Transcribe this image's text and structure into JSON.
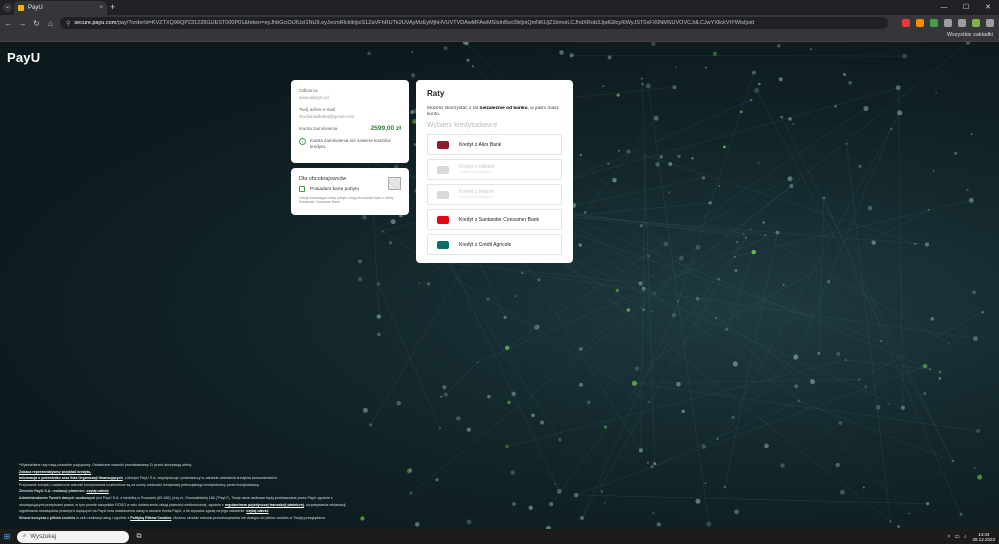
{
  "browser": {
    "tab_title": "PayU",
    "tab_close": "×",
    "new_tab": "+",
    "menu": "⌄",
    "min": "—",
    "max": "☐",
    "close": "✕",
    "back": "←",
    "forward": "→",
    "reload": "↻",
    "home": "⌂",
    "url_host": "secure.payu.com",
    "url_path": "/pay/?orderId=KVZTXQ96QP231228GUEST000P01&token=eyJhbGciOiJIUzI1NiJ9.eyJvcmRlcklkIjoiS1ZaVFhRUTk2UVAyMzEyMjhHVUVTVDAwMFAwMSIsInBvc0lkIjoiQmNKUjZ1bmoiLCJhdXRob3JpdGllcyI6WyJST0xFX0NMSUVOVCJdLCJwYXllckVtYWlsIjoid",
    "bookmarks": "Wszystkie zakładki"
  },
  "page": {
    "logo": "PayU",
    "summary": {
      "recipient_label": "Odbiorca",
      "recipient": "www.allegro.pl",
      "email_label": "Twój adres e-mail",
      "email": "studiobadhabit@gmail.com",
      "amount_label": "Kwota zamówienia",
      "amount": "2599,00 zł",
      "info_icon": "i",
      "info": "Kwota zamówienia nie zawiera kosztów kredytu."
    },
    "foreigners": {
      "title": "Dla obcokrajowców",
      "checkbox_label": "Posiadam kartę pobytu",
      "note": "Usługi dokładające kartę pobytu mogą skorzystać tylko z oferty Santander Consumer Bank."
    },
    "raty": {
      "title": "Raty",
      "desc_pre": "Możesz skorzystać z rat ",
      "desc_bold": "niezależnie od banku",
      "desc_post": ", w jakim masz konto.",
      "subtitle": "Wybierz kredytodawcę",
      "options": [
        {
          "label": "Kredyt z Alior Bank",
          "sub": "",
          "disabled": false,
          "icon": "alior-bank-logo-icon",
          "color": "#8b1e2b"
        },
        {
          "label": "Kredyt z mBank",
          "sub": "Chwilowo niedostępny",
          "disabled": true,
          "icon": "mbank-logo-icon",
          "color": "#d9d9d9"
        },
        {
          "label": "Kredyt z Inbank",
          "sub": "Chwilowo niedostępny",
          "disabled": true,
          "icon": "inbank-logo-icon",
          "color": "#d9d9d9"
        },
        {
          "label": "Kredyt z Santander Consumer Bank",
          "sub": "",
          "disabled": false,
          "icon": "santander-logo-icon",
          "color": "#e30613"
        },
        {
          "label": "Kredyt z Crédit Agricole",
          "sub": "",
          "disabled": false,
          "icon": "credit-agricole-logo-icon",
          "color": "#0a6f6a"
        }
      ]
    },
    "footer": {
      "l1": "*Wyświetlane raty mają charakter poglądowy. Ostateczne warunki przedstawiamy Ci przed akceptacją oferty.",
      "l2": "Zobacz reprezentatywny przykład kredytu.",
      "l3a": "Informacja o pośredniku oraz lista Organizacji finansujących",
      "l3b": ", z którymi PayU S.A. współpracuje i pośredniczy w zakresie udzielania kredytów konsumenckich.",
      "l4": "Przyznanie kredytu i ostateczne warunki kredytowania uzależnione są od oceny zdolności kredytowej potencjalnego kredytobiorcy przez kredytodawcę.",
      "l5a": "Zlecenie PayU S.A. realizacji płatności: ",
      "l5b": "czytaj całość",
      "l6a": "Administratorem Twoich danych osobowych",
      "l6b": " jest PayU S.A. z siedzibą w Poznaniu (60-166), przy ul. Grunwaldzkiej 186 (\"PayU\"). Twoje dane osobowe będą przetwarzane przez PayU zgodnie z",
      "l7a": "obowiązującymi przepisami prawa, w tym przede wszystkim RODO w celu świadczenia usługi płatności elektronicznej, zgodnie z ",
      "l7b": "regulaminem pojedynczej transakcji płatniczej",
      "l7c": ", rozpatrywania reklamacji,",
      "l8a": "wypełniania obowiązków prawnych ciążących na PayU oraz świadczenia usług w ramach Konta PayU, o ile wyrazisz zgodę na jego założenie. ",
      "l8b": "czytaj całość",
      "l9a": "Strona korzysta z plików cookies",
      "l9b": " w celu realizacji usług i zgodnie z ",
      "l9c": "Polityką Plików Cookies",
      "l9d": ". Możesz określić warunki przechowywania lub dostępu do plików cookies w Twojej przeglądarce."
    }
  },
  "taskbar": {
    "start": "⊞",
    "search_icon": "⌕",
    "search_placeholder": "Wyszukaj",
    "taskview": "⧉",
    "tray_up": "˄",
    "time": "14:34",
    "date": "28.12.2023"
  },
  "colors": {
    "accent": "#43a047",
    "amount": "#2e7d32",
    "bg": "#13262a"
  }
}
